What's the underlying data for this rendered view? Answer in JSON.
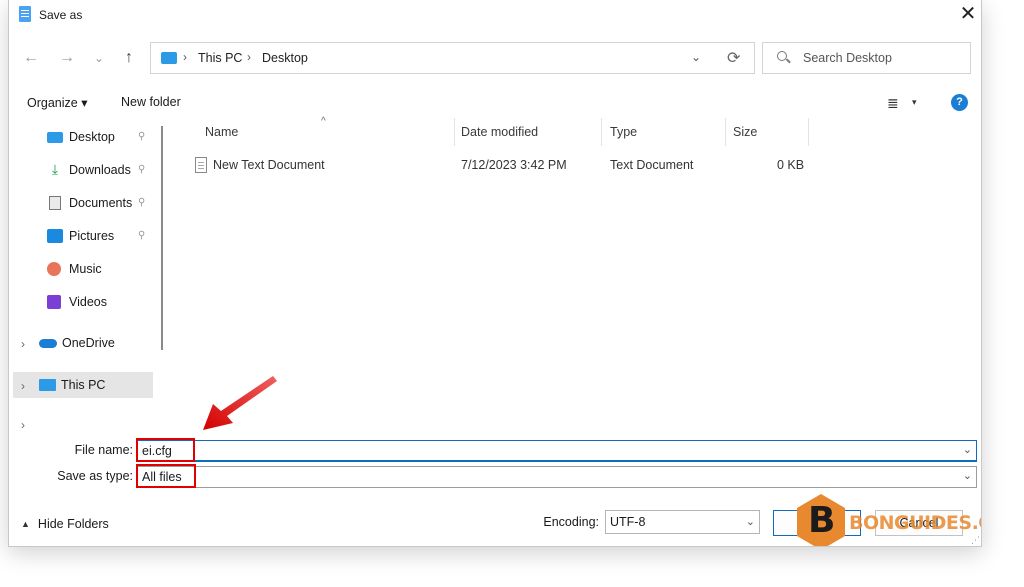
{
  "window": {
    "title": "Save as",
    "close_glyph": "✕"
  },
  "nav_buttons": {
    "back": "←",
    "forward": "→",
    "recent": "⌄",
    "up": "↑"
  },
  "address": {
    "crumbs": [
      "This PC",
      "Desktop"
    ],
    "separator": "›",
    "dropdown_glyph": "⌄",
    "refresh_glyph": "⟳"
  },
  "search": {
    "placeholder": "Search Desktop"
  },
  "toolbar": {
    "organize": "Organize ▾",
    "new_folder": "New folder",
    "view_glyph": "≣",
    "view_caret": "▾",
    "help": "?"
  },
  "nav_pane": {
    "items": [
      {
        "label": "Desktop",
        "icon": "desktop-icon",
        "pinned": true
      },
      {
        "label": "Downloads",
        "icon": "download-icon",
        "pinned": true
      },
      {
        "label": "Documents",
        "icon": "documents-icon",
        "pinned": true
      },
      {
        "label": "Pictures",
        "icon": "pictures-icon",
        "pinned": true
      },
      {
        "label": "Music",
        "icon": "music-icon",
        "pinned": false
      },
      {
        "label": "Videos",
        "icon": "videos-icon",
        "pinned": false
      },
      {
        "label": "OneDrive",
        "icon": "cloud-icon",
        "pinned": false
      },
      {
        "label": "This PC",
        "icon": "computer-icon",
        "pinned": false,
        "selected": true
      }
    ],
    "pin_glyph": "📌",
    "chevron": "›"
  },
  "file_list": {
    "columns": [
      "Name",
      "Date modified",
      "Type",
      "Size"
    ],
    "sort_glyph": "^",
    "rows": [
      {
        "name": "New Text Document",
        "date": "7/12/2023 3:42 PM",
        "type": "Text Document",
        "size": "0 KB"
      }
    ]
  },
  "form": {
    "file_name_label": "File name:",
    "file_name_value": "ei.cfg",
    "save_type_label": "Save as type:",
    "save_type_value": "All files",
    "dropdown_glyph": "⌄"
  },
  "footer": {
    "hide_folders": "Hide Folders",
    "hide_caret": "▲",
    "encoding_label": "Encoding:",
    "encoding_value": "UTF-8",
    "save_button": "Save",
    "cancel_button": "Cancel"
  },
  "watermark": {
    "letter": "B",
    "text": "BONGUIDES.COM"
  },
  "colors": {
    "accent": "#0f6cbd",
    "highlight": "#e00000",
    "arrow": "#e02020",
    "watermark": "#e8892f"
  }
}
